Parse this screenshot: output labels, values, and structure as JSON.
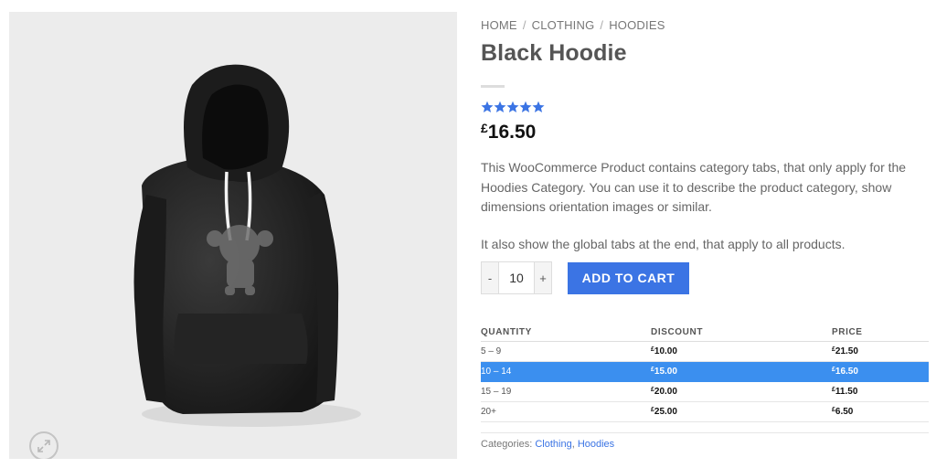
{
  "breadcrumb": [
    "HOME",
    "CLOTHING",
    "HOODIES"
  ],
  "breadcrumb_separator": "/",
  "product": {
    "title": "Black Hoodie",
    "rating": 5,
    "rating_max": 5,
    "currency": "£",
    "price": "16.50",
    "description": [
      "This WooCommerce Product contains category tabs, that only apply for the Hoodies Category. You can use it to describe the product category, show dimensions orientation images or similar.",
      "It also show the global tabs at the end, that apply to all products."
    ]
  },
  "cart": {
    "minus": "-",
    "quantity": "10",
    "plus": "+",
    "add_label": "ADD TO CART"
  },
  "tiers": {
    "headers": [
      "QUANTITY",
      "DISCOUNT",
      "PRICE"
    ],
    "rows": [
      {
        "qty": "5 – 9",
        "discount": "10.00",
        "price": "21.50"
      },
      {
        "qty": "10 – 14",
        "discount": "15.00",
        "price": "16.50",
        "active": true
      },
      {
        "qty": "15 – 19",
        "discount": "20.00",
        "price": "11.50"
      },
      {
        "qty": "20+",
        "discount": "25.00",
        "price": "6.50"
      }
    ]
  },
  "categories": {
    "label": "Categories:",
    "links": [
      "Clothing",
      "Hoodies"
    ],
    "separator": ","
  },
  "icons": {
    "zoom": "expand-arrows-icon",
    "star": "star-icon"
  },
  "colors": {
    "accent": "#3b74e4",
    "active_row": "#3b8fef",
    "star": "#3b74e4",
    "image_bg": "#ececec"
  }
}
